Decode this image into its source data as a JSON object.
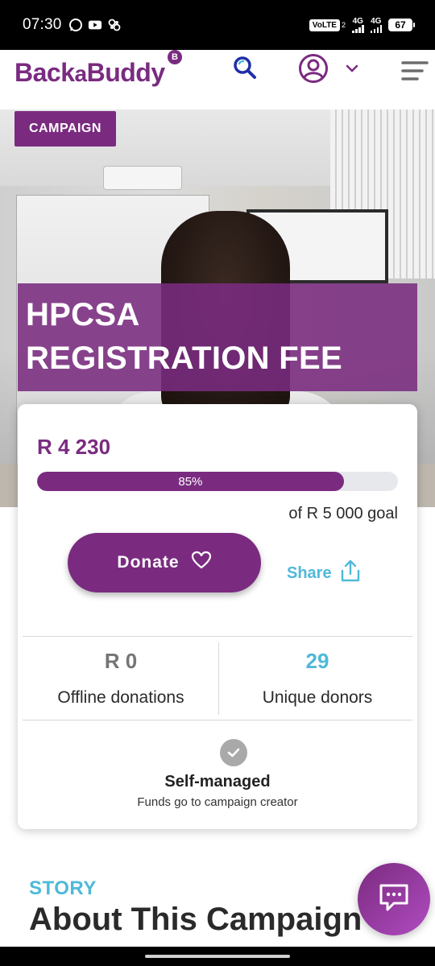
{
  "status_bar": {
    "time": "07:30",
    "volte": "VoLTE",
    "sim2": "2",
    "net1": "4G",
    "net2": "4G",
    "battery": "67"
  },
  "header": {
    "logo_pre": "Back",
    "logo_mid": "a",
    "logo_post": "Buddy",
    "logo_badge": "B",
    "icons": {
      "search": "search-icon",
      "user": "user-circle-icon",
      "chevron": "chevron-down-icon",
      "menu": "hamburger-menu-icon"
    }
  },
  "hero": {
    "tag": "CAMPAIGN",
    "title": "HPCSA\nREGISTRATION FEE"
  },
  "card": {
    "raised": "R 4 230",
    "progress_percent": 85,
    "progress_label": "85%",
    "goal": "of R 5 000 goal",
    "donate_label": "Donate",
    "share_label": "Share",
    "offline_value": "R 0",
    "offline_label": "Offline donations",
    "donors_value": "29",
    "donors_label": "Unique donors",
    "managed_title": "Self-managed",
    "managed_sub": "Funds go to campaign creator"
  },
  "story": {
    "label": "STORY",
    "heading": "About This Campaign"
  },
  "colors": {
    "brand_purple": "#7a2b80",
    "accent_blue": "#4fb9d9",
    "search_blue": "#1f2fa8",
    "grey_value": "#757575"
  }
}
